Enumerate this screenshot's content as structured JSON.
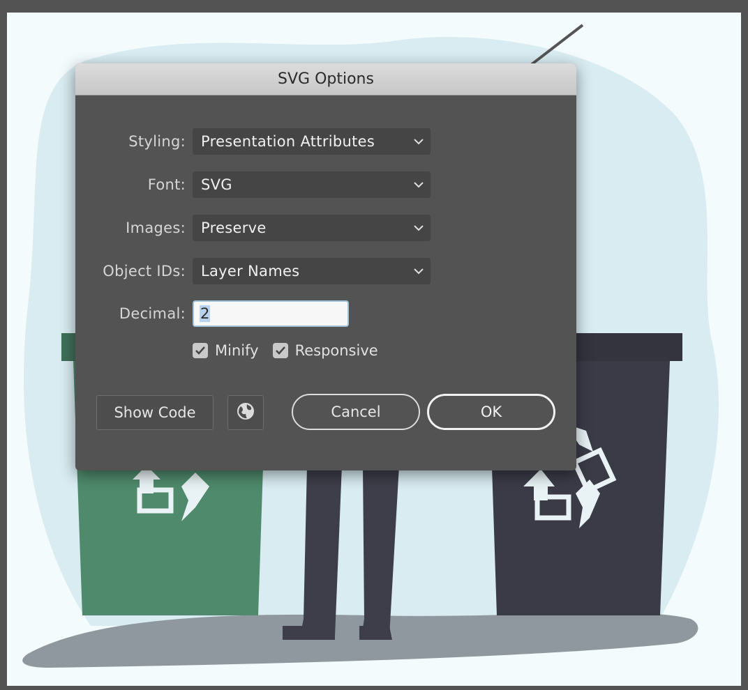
{
  "dialog": {
    "title": "SVG Options",
    "fields": {
      "styling": {
        "label": "Styling:",
        "value": "Presentation Attributes"
      },
      "font": {
        "label": "Font:",
        "value": "SVG"
      },
      "images": {
        "label": "Images:",
        "value": "Preserve"
      },
      "object_ids": {
        "label": "Object IDs:",
        "value": "Layer Names"
      },
      "decimal": {
        "label": "Decimal:",
        "value": "2"
      }
    },
    "checkboxes": {
      "minify": {
        "label": "Minify",
        "checked": true
      },
      "responsive": {
        "label": "Responsive",
        "checked": true
      }
    },
    "buttons": {
      "show_code": "Show Code",
      "web_icon": "globe-icon",
      "cancel": "Cancel",
      "ok": "OK"
    }
  },
  "colors": {
    "dialog_bg": "#535353",
    "titlebar": "#d1d1d1",
    "green_bin": "#4f8a6c",
    "dark_bin": "#3b3b48"
  }
}
